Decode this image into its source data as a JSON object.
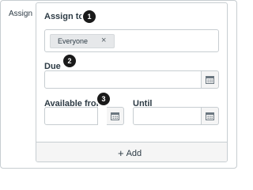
{
  "section": {
    "label": "Assign"
  },
  "assign_to": {
    "label": "Assign to",
    "step": "1",
    "tokens": [
      {
        "label": "Everyone",
        "remove_icon": "×"
      }
    ]
  },
  "due": {
    "label": "Due",
    "step": "2",
    "value": "",
    "calendar_icon": "calendar-icon"
  },
  "available_from": {
    "label": "Available from",
    "step": "3",
    "value": "",
    "calendar_icon": "calendar-icon"
  },
  "until": {
    "label": "Until",
    "value": "",
    "calendar_icon": "calendar-icon"
  },
  "add_button": {
    "icon": "+",
    "label": "Add"
  },
  "colors": {
    "badge": "#1a1a1a",
    "border": "#c7cdd1",
    "token_bg": "#e6e8ea",
    "footer_bg": "#f5f5f5"
  }
}
